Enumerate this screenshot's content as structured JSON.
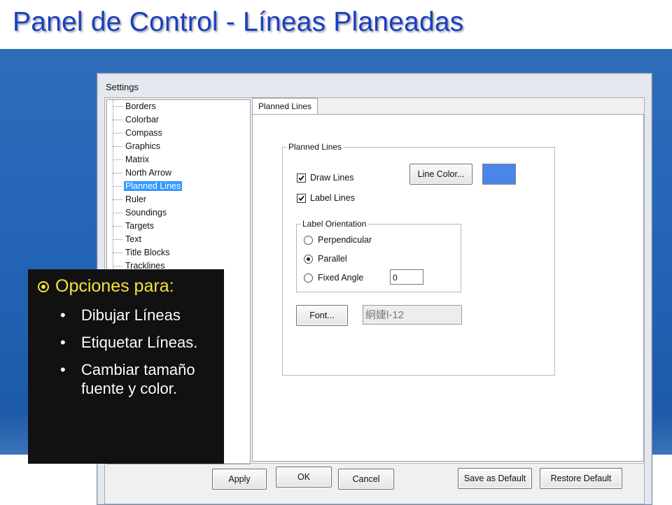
{
  "slide": {
    "title": "Panel de Control - Líneas Planeadas"
  },
  "dialog": {
    "title": "Settings",
    "tree": {
      "items": [
        {
          "label": "Borders",
          "selected": false
        },
        {
          "label": "Colorbar",
          "selected": false
        },
        {
          "label": "Compass",
          "selected": false
        },
        {
          "label": "Graphics",
          "selected": false
        },
        {
          "label": "Matrix",
          "selected": false
        },
        {
          "label": "North Arrow",
          "selected": false
        },
        {
          "label": "Planned Lines",
          "selected": true
        },
        {
          "label": "Ruler",
          "selected": false
        },
        {
          "label": "Soundings",
          "selected": false
        },
        {
          "label": "Targets",
          "selected": false
        },
        {
          "label": "Text",
          "selected": false
        },
        {
          "label": "Title Blocks",
          "selected": false
        },
        {
          "label": "Tracklines",
          "selected": false
        }
      ]
    },
    "tab": {
      "label": "Planned Lines"
    },
    "planned_lines_group": {
      "legend": "Planned Lines",
      "draw_lines": {
        "label": "Draw Lines",
        "checked": true
      },
      "label_lines": {
        "label": "Label Lines",
        "checked": true
      },
      "line_color_button": "Line Color...",
      "line_color": "#4a86e8"
    },
    "label_orientation_group": {
      "legend": "Label Orientation",
      "options": [
        {
          "label": "Perpendicular",
          "selected": false
        },
        {
          "label": "Parallel",
          "selected": true
        },
        {
          "label": "Fixed Angle",
          "selected": false
        }
      ],
      "fixed_angle_value": "0"
    },
    "font": {
      "button": "Font...",
      "preview": "絅婕l-12"
    },
    "buttons": {
      "apply": "Apply",
      "ok": "OK",
      "cancel": "Cancel",
      "save_default": "Save as Default",
      "restore_default": "Restore Default"
    }
  },
  "overlay": {
    "heading": "Opciones para:",
    "bullet_glyph": "•",
    "items": [
      "Dibujar Líneas",
      "Etiquetar Líneas.",
      "Cambiar tamaño fuente y color."
    ]
  }
}
